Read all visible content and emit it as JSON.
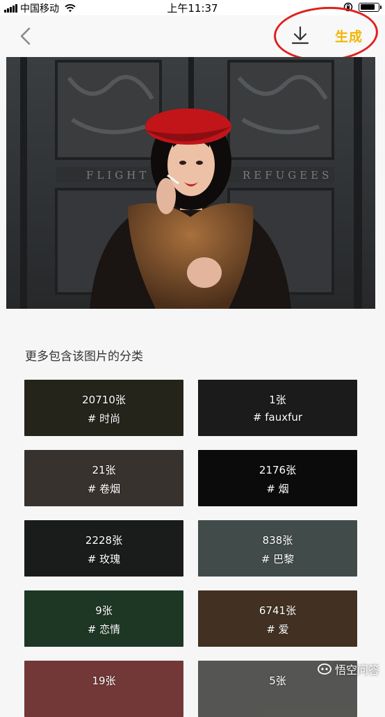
{
  "status_bar": {
    "carrier": "中国移动",
    "time": "上午11:37",
    "battery_level": 0.85
  },
  "nav": {
    "back_icon": "chevron-left-icon",
    "download_icon": "download-icon",
    "generate_label": "生成",
    "accent_color": "#f4b400",
    "highlight_color": "#e0201e"
  },
  "section": {
    "title": "更多包含该图片的分类"
  },
  "categories": [
    {
      "count": "20710张",
      "tag": "# 时尚",
      "bg": "#3a3a2a"
    },
    {
      "count": "1张",
      "tag": "# fauxfur",
      "bg": "#2c2c2c"
    },
    {
      "count": "21张",
      "tag": "# 卷烟",
      "bg": "#5b524c"
    },
    {
      "count": "2176张",
      "tag": "# 烟",
      "bg": "#121212"
    },
    {
      "count": "2228张",
      "tag": "# 玫瑰",
      "bg": "#2a2e2c"
    },
    {
      "count": "838张",
      "tag": "# 巴黎",
      "bg": "#6a7a76"
    },
    {
      "count": "9张",
      "tag": "# 恋情",
      "bg": "#2f5a3a"
    },
    {
      "count": "6741张",
      "tag": "# 爱",
      "bg": "#6b5038"
    },
    {
      "count": "19张",
      "tag": "",
      "bg": "#b85a5a"
    },
    {
      "count": "5张",
      "tag": "",
      "bg": "#8a8a86"
    }
  ],
  "watermark": {
    "text": "悟空问答"
  }
}
